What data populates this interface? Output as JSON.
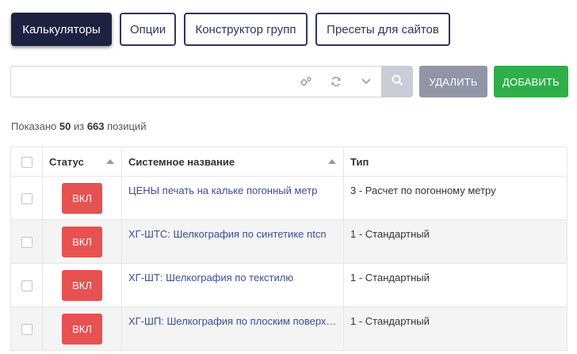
{
  "tabs": [
    {
      "label": "Калькуляторы",
      "active": true
    },
    {
      "label": "Опции",
      "active": false
    },
    {
      "label": "Конструктор групп",
      "active": false
    },
    {
      "label": "Пресеты для сайтов",
      "active": false
    }
  ],
  "toolbar": {
    "search_placeholder": "",
    "search_value": "",
    "delete_label": "УДАЛИТЬ",
    "add_label": "ДОБАВИТЬ",
    "icons": [
      "settings-icon",
      "refresh-icon",
      "chevron-down-icon",
      "search-icon"
    ]
  },
  "summary": {
    "prefix": "Показано",
    "shown": "50",
    "middle": "из",
    "total": "663",
    "suffix": "позиций"
  },
  "table": {
    "headers": {
      "status": "Статус",
      "name": "Системное название",
      "type": "Тип"
    },
    "rows": [
      {
        "status": "ВКЛ",
        "name": "ЦЕНЫ печать на кальке погонный метр",
        "type": "3 - Расчет по погонному метру"
      },
      {
        "status": "ВКЛ",
        "name": "ХГ-ШТС: Шелкография по синтетике ntcn",
        "type": "1 - Стандартный"
      },
      {
        "status": "ВКЛ",
        "name": "ХГ-ШТ: Шелкография по текстилю",
        "type": "1 - Стандартный"
      },
      {
        "status": "ВКЛ",
        "name": "ХГ-ШП: Шелкография по плоским поверх…",
        "type": "1 - Стандартный"
      }
    ]
  },
  "colors": {
    "active_tab_bg": "#1e2140",
    "tab_border": "#2f3659",
    "delete_bg": "#9096a6",
    "add_bg": "#2fae4a",
    "status_badge_bg": "#e85151",
    "link_color": "#3a4f8f"
  }
}
